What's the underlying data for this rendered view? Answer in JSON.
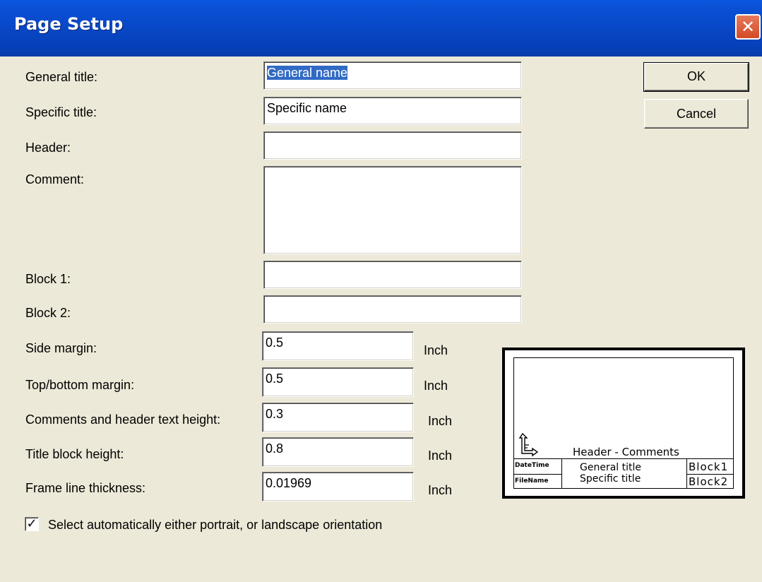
{
  "window": {
    "title": "Page Setup",
    "close_glyph": "✕"
  },
  "fields": {
    "general_title": {
      "label": "General title:",
      "value": "General name"
    },
    "specific_title": {
      "label": "Specific title:",
      "value": "Specific name"
    },
    "header": {
      "label": "Header:",
      "value": ""
    },
    "comment": {
      "label": "Comment:",
      "value": ""
    },
    "block1": {
      "label": "Block 1:",
      "value": ""
    },
    "block2": {
      "label": "Block 2:",
      "value": ""
    },
    "side_margin": {
      "label": "Side margin:",
      "value": "0.5",
      "unit": "Inch"
    },
    "top_bottom_margin": {
      "label": "Top/bottom margin:",
      "value": "0.5",
      "unit": "Inch"
    },
    "text_height": {
      "label": "Comments and header text height:",
      "value": "0.3",
      "unit": "Inch"
    },
    "title_block_height": {
      "label": "Title block height:",
      "value": "0.8",
      "unit": "Inch"
    },
    "frame_line_thickness": {
      "label": "Frame line thickness:",
      "value": "0.01969",
      "unit": "Inch"
    }
  },
  "buttons": {
    "ok": "OK",
    "cancel": "Cancel"
  },
  "orientation_checkbox": {
    "checked": true,
    "mark": "✓",
    "label": "Select automatically either portrait, or landscape orientation"
  },
  "preview": {
    "header_comments": "Header - Comments",
    "date_time": "DateTime",
    "file_name": "FileName",
    "general_title": "General  title",
    "specific_title": "Specific  title",
    "block1": "Block1",
    "block2": "Block2"
  },
  "colors": {
    "titlebar": "#0846c5",
    "selection": "#316ac5",
    "face": "#ece9d8",
    "close": "#d44a26"
  }
}
